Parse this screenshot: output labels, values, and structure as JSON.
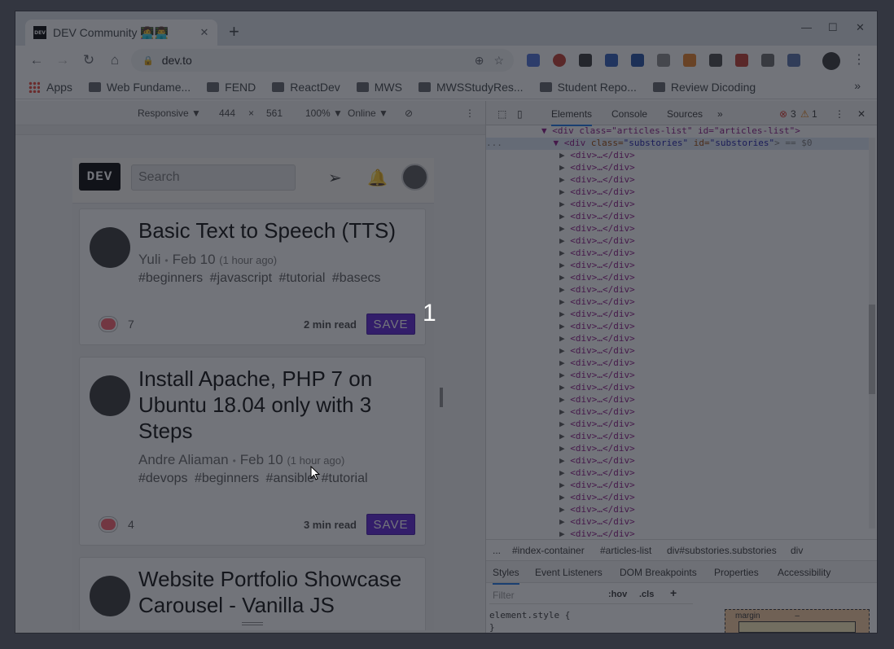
{
  "browser": {
    "tab_title": "DEV Community 👩‍💻👨‍💻",
    "favicon_text": "DEV",
    "url": "dev.to",
    "bookmarks": [
      "Apps",
      "Web Fundame...",
      "FEND",
      "ReactDev",
      "MWS",
      "MWSStudyRes...",
      "Student Repo...",
      "Review Dicoding"
    ],
    "bookmarks_more": "»"
  },
  "device_toolbar": {
    "mode": "Responsive ▼",
    "width": "444",
    "times": "×",
    "height": "561",
    "zoom": "100% ▼",
    "network": "Online ▼"
  },
  "site": {
    "logo": "DEV",
    "search_placeholder": "Search"
  },
  "articles": [
    {
      "title": "Basic Text to Speech (TTS)",
      "author": "Yuli",
      "date": "Feb 10",
      "ago": "(1 hour ago)",
      "tags": "#beginners #javascript #tutorial #basecs",
      "reactions": "7",
      "read_time": "2 min read",
      "save": "SAVE"
    },
    {
      "title": "Install Apache, PHP 7 on Ubuntu 18.04 only with 3 Steps",
      "author": "Andre Aliaman",
      "date": "Feb 10",
      "ago": "(1 hour ago)",
      "tags": "#devops #beginners #ansible #tutorial",
      "reactions": "4",
      "read_time": "3 min read",
      "save": "SAVE"
    },
    {
      "title": "Website Portfolio Showcase Carousel - Vanilla JS"
    }
  ],
  "overlay_number": "1",
  "devtools": {
    "tabs": [
      "Elements",
      "Console",
      "Sources",
      "»"
    ],
    "errors": "3",
    "warnings": "1",
    "dom_open_1": "<div class=\"articles-list\" id=\"articles-list\">",
    "dom_open_2_tag": "<div",
    "dom_open_2_attr1": " class=",
    "dom_open_2_val1": "\"substories\"",
    "dom_open_2_attr2": " id=",
    "dom_open_2_val2": "\"substories\"",
    "dom_open_2_end": "> == $0",
    "dom_child": "<div>…</div>",
    "ellipsis": "...",
    "breadcrumbs": [
      "...",
      "#index-container",
      "#articles-list",
      "div#substories.substories",
      "div"
    ],
    "subtabs": [
      "Styles",
      "Event Listeners",
      "DOM Breakpoints",
      "Properties",
      "Accessibility"
    ],
    "filter_placeholder": "Filter",
    "hov": ":hov",
    "cls": ".cls",
    "plus": "+",
    "element_style": "element.style {",
    "element_style_close": "}",
    "box_margin": "margin",
    "box_dash": "–"
  }
}
